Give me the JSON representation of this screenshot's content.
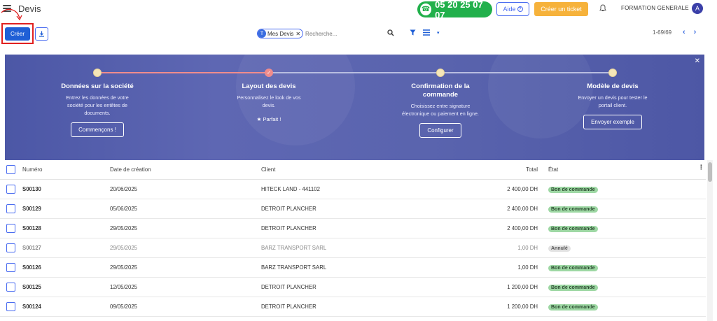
{
  "app": {
    "title": "Devis"
  },
  "header": {
    "phone": "05 20 25 07 07",
    "help_label": "Aide",
    "ticket_label": "Créer un ticket",
    "company": "FORMATION GENERALE",
    "avatar_initial": "A"
  },
  "toolbar": {
    "create_label": "Créer",
    "search_facet": "Mes Devis",
    "search_placeholder": "Recherche...",
    "pager": "1-69/69"
  },
  "onboarding": {
    "steps": [
      {
        "title": "Données sur la société",
        "desc": "Entrez les données de votre société pour les entêtes de documents.",
        "button": "Commençons !",
        "done": false
      },
      {
        "title": "Layout des devis",
        "desc": "Personnalisez le look de vos devis.",
        "status": "Parfait !",
        "done": true
      },
      {
        "title": "Confirmation de la commande",
        "desc": "Choisissez entre signature électronique ou paiement en ligne.",
        "button": "Configurer",
        "done": false
      },
      {
        "title": "Modèle de devis",
        "desc": "Envoyer un devis pour tester le portail client.",
        "button": "Envoyer exemple",
        "done": false
      }
    ]
  },
  "table": {
    "columns": {
      "number": "Numéro",
      "date": "Date de création",
      "client": "Client",
      "total": "Total",
      "state": "État"
    },
    "rows": [
      {
        "number": "S00130",
        "date": "20/06/2025",
        "client": "HITECK LAND - 441102",
        "total": "2 400,00 DH",
        "state": "Bon de commande",
        "state_type": "green"
      },
      {
        "number": "S00129",
        "date": "05/06/2025",
        "client": "DETROIT PLANCHER",
        "total": "2 400,00 DH",
        "state": "Bon de commande",
        "state_type": "green"
      },
      {
        "number": "S00128",
        "date": "29/05/2025",
        "client": "DETROIT PLANCHER",
        "total": "2 400,00 DH",
        "state": "Bon de commande",
        "state_type": "green"
      },
      {
        "number": "S00127",
        "date": "29/05/2025",
        "client": "BARZ TRANSPORT SARL",
        "total": "1,00 DH",
        "state": "Annulé",
        "state_type": "grey"
      },
      {
        "number": "S00126",
        "date": "29/05/2025",
        "client": "BARZ TRANSPORT SARL",
        "total": "1,00 DH",
        "state": "Bon de commande",
        "state_type": "green"
      },
      {
        "number": "S00125",
        "date": "12/05/2025",
        "client": "DETROIT PLANCHER",
        "total": "1 200,00 DH",
        "state": "Bon de commande",
        "state_type": "green"
      },
      {
        "number": "S00124",
        "date": "09/05/2025",
        "client": "DETROIT PLANCHER",
        "total": "1 200,00 DH",
        "state": "Bon de commande",
        "state_type": "green"
      }
    ]
  }
}
